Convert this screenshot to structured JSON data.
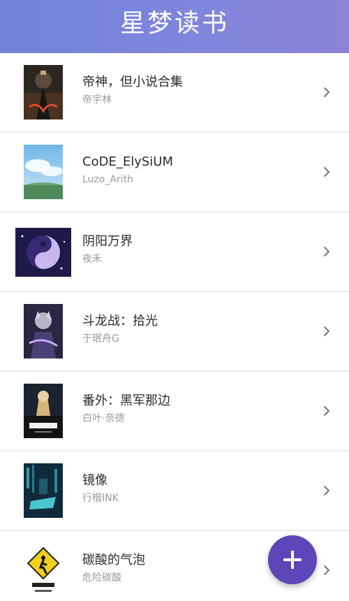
{
  "app": {
    "title": "星梦读书",
    "accent": "#6f83d9"
  },
  "books": [
    {
      "title": "帝神，但小说合集",
      "author": "帝宇林"
    },
    {
      "title": "CoDE_ElySiUM",
      "author": "Luzo_Arith"
    },
    {
      "title": "阴阳万界",
      "author": "夜禾"
    },
    {
      "title": "斗龙战：拾光",
      "author": "于珉舟G"
    },
    {
      "title": "番外：黑军那边",
      "author": "白叶·奈德"
    },
    {
      "title": "镜像",
      "author": "行楷INK"
    },
    {
      "title": "碳酸的气泡",
      "author": "危险碳酸"
    }
  ],
  "fab": {
    "icon": "plus-icon",
    "color": "#5d46b8"
  },
  "icons": {
    "row_arrow": "chevron-right-icon"
  }
}
